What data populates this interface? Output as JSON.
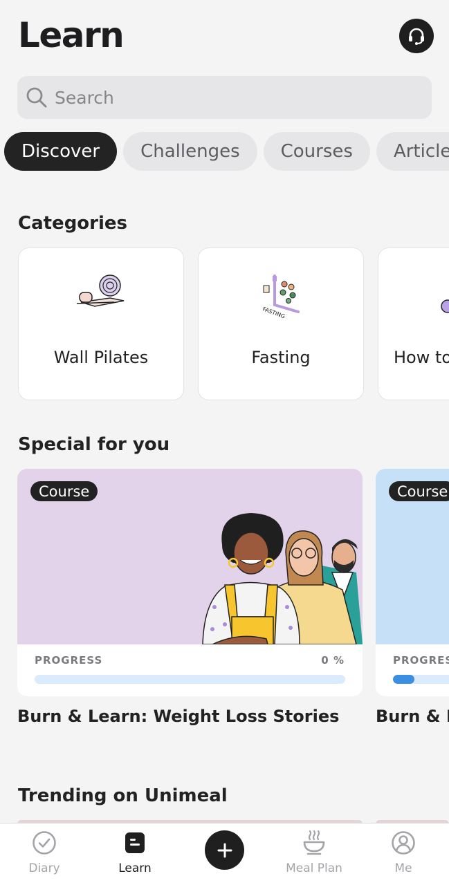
{
  "header": {
    "title": "Learn"
  },
  "search": {
    "placeholder": "Search"
  },
  "tabs": [
    {
      "label": "Discover",
      "active": true
    },
    {
      "label": "Challenges",
      "active": false
    },
    {
      "label": "Courses",
      "active": false
    },
    {
      "label": "Articles",
      "active": false
    }
  ],
  "categories": {
    "title": "Categories",
    "items": [
      {
        "label": "Wall Pilates",
        "icon": "yoga-mat-icon"
      },
      {
        "label": "Fasting",
        "icon": "fasting-icon"
      },
      {
        "label": "How to",
        "icon": "category-icon"
      }
    ]
  },
  "special": {
    "title": "Special for you",
    "items": [
      {
        "badge": "Course",
        "progress_label": "PROGRESS",
        "progress_text": "0 %",
        "progress": 0,
        "title": "Burn & Learn: Weight Loss Stories",
        "hero_color": "#e2d2ea"
      },
      {
        "badge": "Course",
        "progress_label": "PROGRESS",
        "progress": 0.07,
        "title": "Burn & Learn",
        "hero_color": "#c6e0f8"
      }
    ]
  },
  "trending": {
    "title": "Trending on Unimeal"
  },
  "nav": {
    "diary": "Diary",
    "learn": "Learn",
    "meal_plan": "Meal Plan",
    "me": "Me",
    "active": "Learn"
  },
  "colors": {
    "background": "#f4f4f5",
    "dark": "#1f1f1f",
    "progress_fill": "#3a8fe2",
    "progress_track": "#d9ebfc"
  }
}
